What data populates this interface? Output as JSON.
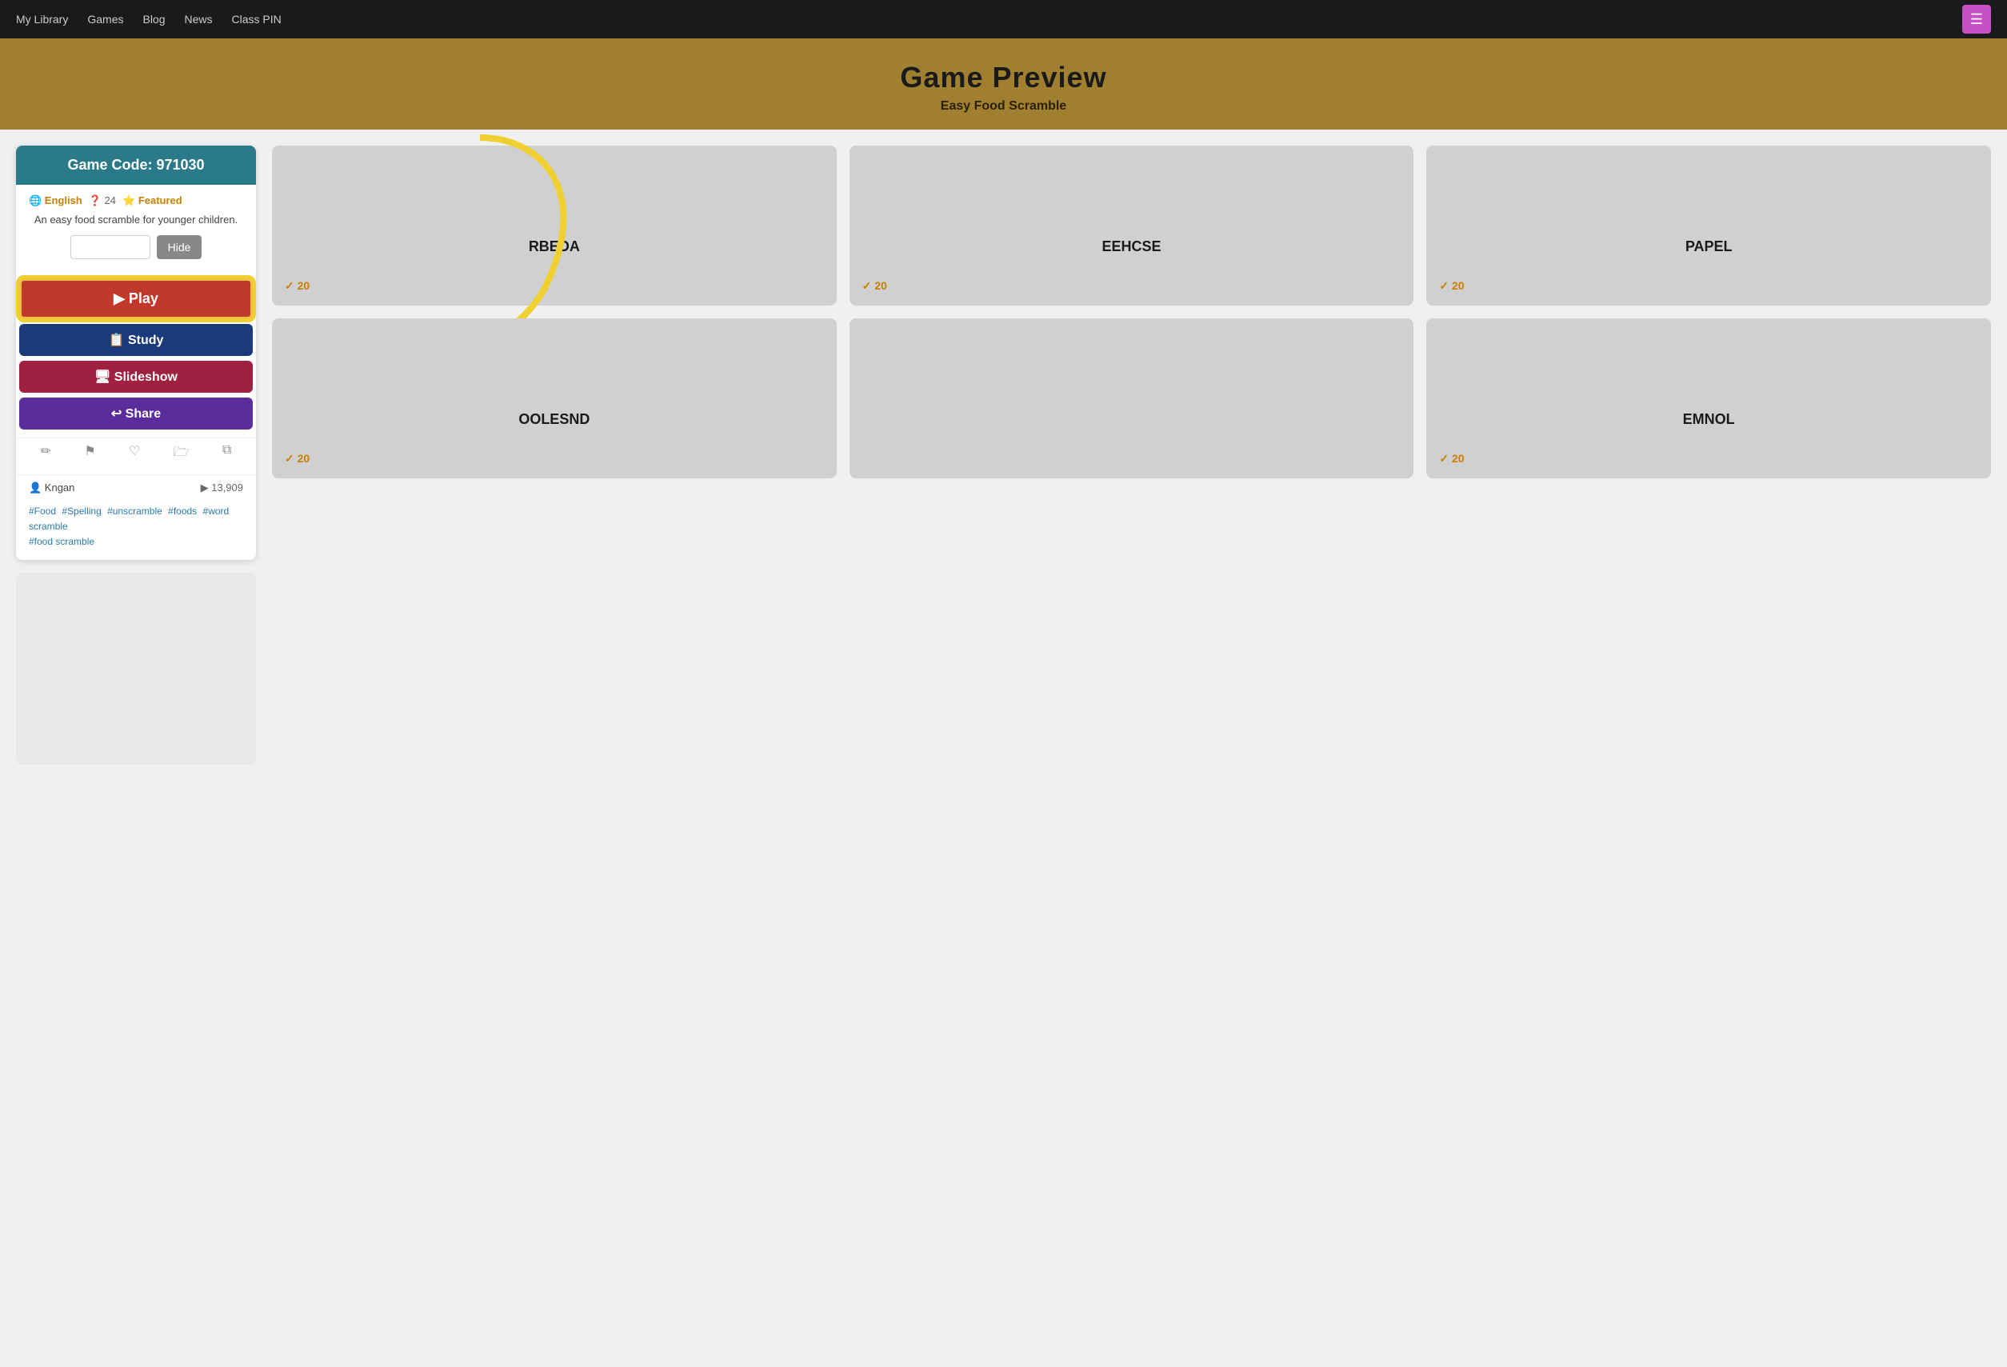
{
  "nav": {
    "links": [
      "My Library",
      "Games",
      "Blog",
      "News",
      "Class PIN"
    ],
    "menu_icon": "☰"
  },
  "header": {
    "title": "Game Preview",
    "subtitle": "Easy Food Scramble"
  },
  "game_card": {
    "code_label": "Game Code: 971030",
    "lang": "🌐 English",
    "count": "❓ 24",
    "featured": "⭐ Featured",
    "description": "An easy food scramble for younger children.",
    "hide_label": "Hide",
    "btn_play": "▶ Play",
    "btn_study": "📋 Study",
    "btn_slideshow": "🖥 Slideshow",
    "btn_share": "↩ Share",
    "author": "👤 Kngan",
    "play_count": "▶ 13,909",
    "tags": [
      "#Food",
      "#Spelling",
      "#unscramble",
      "#foods",
      "#word scramble",
      "#food scramble"
    ],
    "icons": [
      "✏",
      "🚩",
      "♥",
      "📁",
      "⧉"
    ]
  },
  "grid_cards": [
    {
      "word": "RBEDA",
      "score": "✓ 20",
      "has_score": true
    },
    {
      "word": "EEHCSE",
      "score": "✓ 20",
      "has_score": true
    },
    {
      "word": "PAPEL",
      "score": "✓ 20",
      "has_score": true
    },
    {
      "word": "OOLESND",
      "score": "✓ 20",
      "has_score": true
    },
    {
      "word": "",
      "score": "",
      "has_score": false
    },
    {
      "word": "EMNOL",
      "score": "✓ 20",
      "has_score": true
    }
  ]
}
